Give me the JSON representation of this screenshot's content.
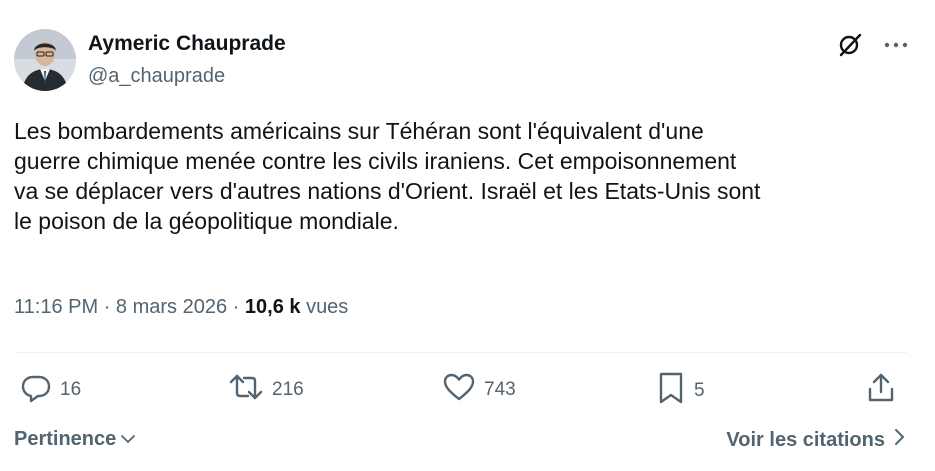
{
  "author": {
    "display_name": "Aymeric Chauprade",
    "handle": "@a_chauprade"
  },
  "header_icons": {
    "grok": "grok-icon",
    "more": "more-icon"
  },
  "tweet": {
    "lines": [
      "Les bombardements américains sur Téhéran sont l'équivalent d'une",
      "guerre chimique menée contre les civils iraniens. Cet empoisonnement",
      "va se déplacer vers d'autres nations d'Orient. Israël et les Etats-Unis sont",
      "le poison de la géopolitique mondiale."
    ]
  },
  "meta": {
    "time": "11:16 PM",
    "separator": "·",
    "date": "8 mars 2026",
    "views_count": "10,6 k",
    "views_label": "vues"
  },
  "actions": {
    "replies": "16",
    "reposts": "216",
    "likes": "743",
    "bookmarks": "5"
  },
  "footer": {
    "sort_label": "Pertinence",
    "quotes_label": "Voir les citations"
  },
  "colors": {
    "text": "#0f1419",
    "secondary": "#536471",
    "divider": "#eff3f4"
  }
}
